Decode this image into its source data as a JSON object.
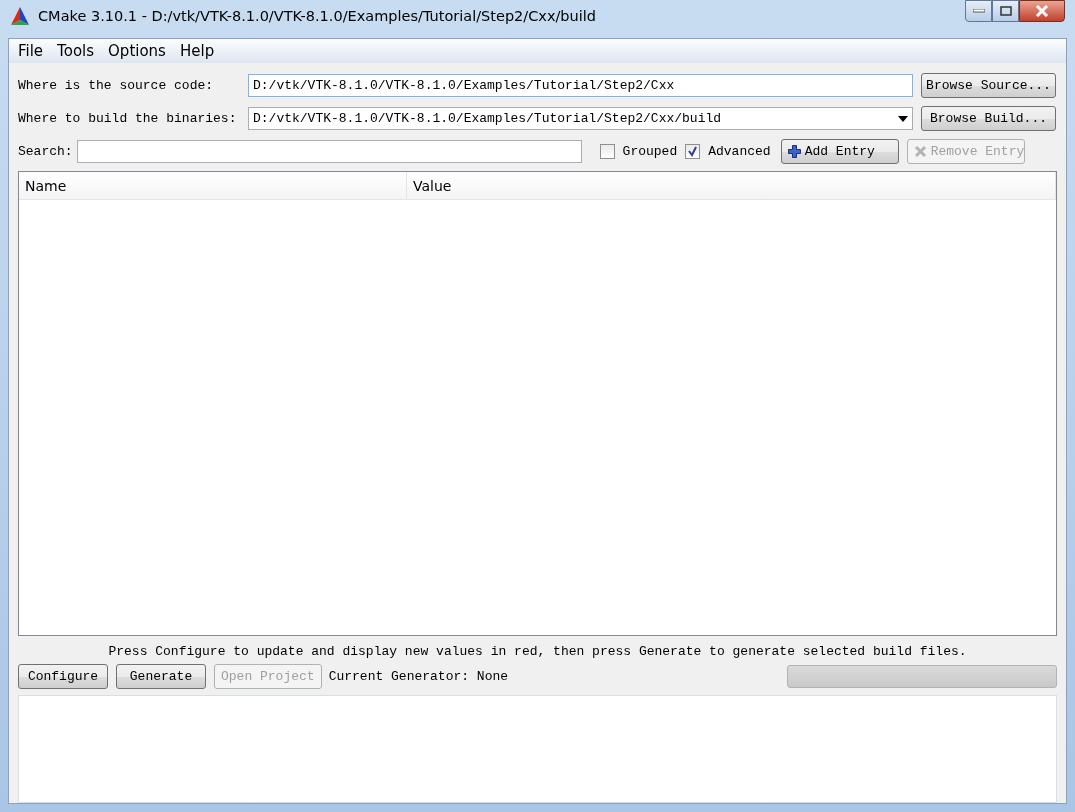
{
  "window": {
    "title": "CMake 3.10.1 - D:/vtk/VTK-8.1.0/VTK-8.1.0/Examples/Tutorial/Step2/Cxx/build"
  },
  "menu": [
    {
      "label": "File"
    },
    {
      "label": "Tools"
    },
    {
      "label": "Options"
    },
    {
      "label": "Help"
    }
  ],
  "source": {
    "label": "Where is the source code:",
    "value": "D:/vtk/VTK-8.1.0/VTK-8.1.0/Examples/Tutorial/Step2/Cxx",
    "button": "Browse Source..."
  },
  "build": {
    "label": "Where to build the binaries:",
    "value": "D:/vtk/VTK-8.1.0/VTK-8.1.0/Examples/Tutorial/Step2/Cxx/build",
    "button": "Browse Build..."
  },
  "search": {
    "label": "Search:"
  },
  "options": [
    {
      "label": "Grouped",
      "checked": false
    },
    {
      "label": "Advanced",
      "checked": true
    }
  ],
  "entry_buttons": [
    {
      "label": "Add Entry",
      "kind": "add",
      "disabled": false
    },
    {
      "label": "Remove Entry",
      "kind": "remove",
      "disabled": true
    }
  ],
  "table": {
    "columns": [
      "Name",
      "Value"
    ]
  },
  "hint": "Press Configure to update and display new values in red, then press Generate to generate selected build files.",
  "actions": [
    {
      "label": "Configure",
      "disabled": false
    },
    {
      "label": "Generate",
      "disabled": false
    },
    {
      "label": "Open Project",
      "disabled": true
    }
  ],
  "generator": "Current Generator: None",
  "progress": {
    "level": 0
  }
}
